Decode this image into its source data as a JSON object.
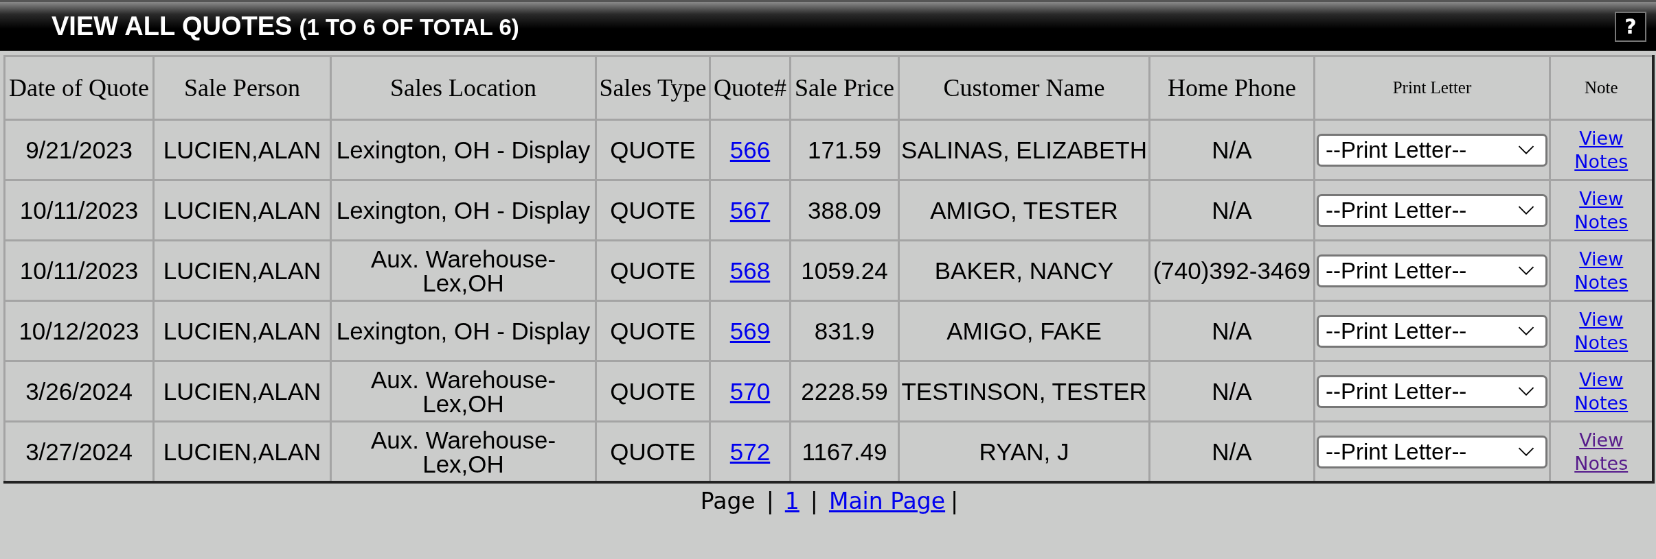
{
  "header": {
    "title": "VIEW ALL QUOTES",
    "range": "(1 TO 6 OF TOTAL 6)",
    "help_button": "?"
  },
  "table": {
    "columns": [
      "Date of Quote",
      "Sale Person",
      "Sales Location",
      "Sales Type",
      "Quote#",
      "Sale Price",
      "Customer Name",
      "Home Phone",
      "Print Letter",
      "Note"
    ],
    "rows": [
      {
        "date": "9/21/2023",
        "sale_person": "LUCIEN,ALAN",
        "sales_location": "Lexington, OH - Display",
        "sales_type": "QUOTE",
        "quote_no": "566",
        "sale_price": "171.59",
        "customer_name": "SALINAS, ELIZABETH",
        "home_phone": "N/A",
        "print_letter": "--Print Letter--",
        "note_link": {
          "label": "View Notes",
          "visited": false
        }
      },
      {
        "date": "10/11/2023",
        "sale_person": "LUCIEN,ALAN",
        "sales_location": "Lexington, OH - Display",
        "sales_type": "QUOTE",
        "quote_no": "567",
        "sale_price": "388.09",
        "customer_name": "AMIGO, TESTER",
        "home_phone": "N/A",
        "print_letter": "--Print Letter--",
        "note_link": {
          "label": "View Notes",
          "visited": false
        }
      },
      {
        "date": "10/11/2023",
        "sale_person": "LUCIEN,ALAN",
        "sales_location": "Aux. Warehouse-Lex,OH",
        "sales_type": "QUOTE",
        "quote_no": "568",
        "sale_price": "1059.24",
        "customer_name": "BAKER, NANCY",
        "home_phone": "(740)392-3469",
        "print_letter": "--Print Letter--",
        "note_link": {
          "label": "View Notes",
          "visited": false
        }
      },
      {
        "date": "10/12/2023",
        "sale_person": "LUCIEN,ALAN",
        "sales_location": "Lexington, OH - Display",
        "sales_type": "QUOTE",
        "quote_no": "569",
        "sale_price": "831.9",
        "customer_name": "AMIGO, FAKE",
        "home_phone": "N/A",
        "print_letter": "--Print Letter--",
        "note_link": {
          "label": "View Notes",
          "visited": false
        }
      },
      {
        "date": "3/26/2024",
        "sale_person": "LUCIEN,ALAN",
        "sales_location": "Aux. Warehouse-Lex,OH",
        "sales_type": "QUOTE",
        "quote_no": "570",
        "sale_price": "2228.59",
        "customer_name": "TESTINSON, TESTER",
        "home_phone": "N/A",
        "print_letter": "--Print Letter--",
        "note_link": {
          "label": "View Notes",
          "visited": false
        }
      },
      {
        "date": "3/27/2024",
        "sale_person": "LUCIEN,ALAN",
        "sales_location": "Aux. Warehouse-Lex,OH",
        "sales_type": "QUOTE",
        "quote_no": "572",
        "sale_price": "1167.49",
        "customer_name": "RYAN, J",
        "home_phone": "N/A",
        "print_letter": "--Print Letter--",
        "note_link": {
          "label": "View Notes",
          "visited": true
        }
      }
    ]
  },
  "footer": [
    {
      "kind": "text",
      "label": "Page"
    },
    {
      "kind": "text",
      "label": "|"
    },
    {
      "kind": "link",
      "label": "1"
    },
    {
      "kind": "text",
      "label": "|"
    },
    {
      "kind": "link",
      "label": "Main Page"
    },
    {
      "kind": "text",
      "label": "|"
    }
  ]
}
